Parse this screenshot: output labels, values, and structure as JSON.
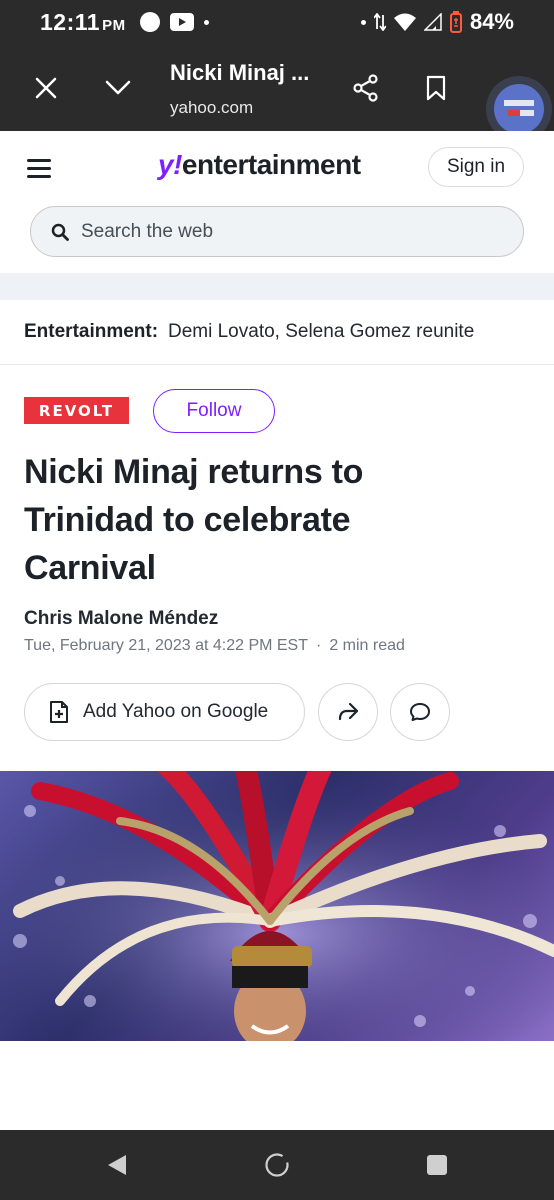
{
  "status": {
    "time": "12:11",
    "ampm": "PM",
    "battery": "84%"
  },
  "browser": {
    "title": "Nicki Minaj ...",
    "domain": "yahoo.com"
  },
  "header": {
    "logo_y": "y!",
    "logo_text": "entertainment",
    "signin_label": "Sign in",
    "search_placeholder": "Search the web"
  },
  "trending": {
    "label": "Entertainment:",
    "text": "Demi Lovato, Selena Gomez reunite"
  },
  "article": {
    "publisher": "REVOLT",
    "follow_label": "Follow",
    "headline": "Nicki Minaj returns to Trinidad to celebrate Carnival",
    "author": "Chris Malone Méndez",
    "date": "Tue, February 21, 2023 at 4:22 PM EST",
    "separator": "·",
    "read_time": "2 min read",
    "add_google_label": "Add Yahoo on Google"
  },
  "colors": {
    "brand": "#7e1fff",
    "publisher": "#e8323c",
    "chrome": "#2b2b2b"
  }
}
